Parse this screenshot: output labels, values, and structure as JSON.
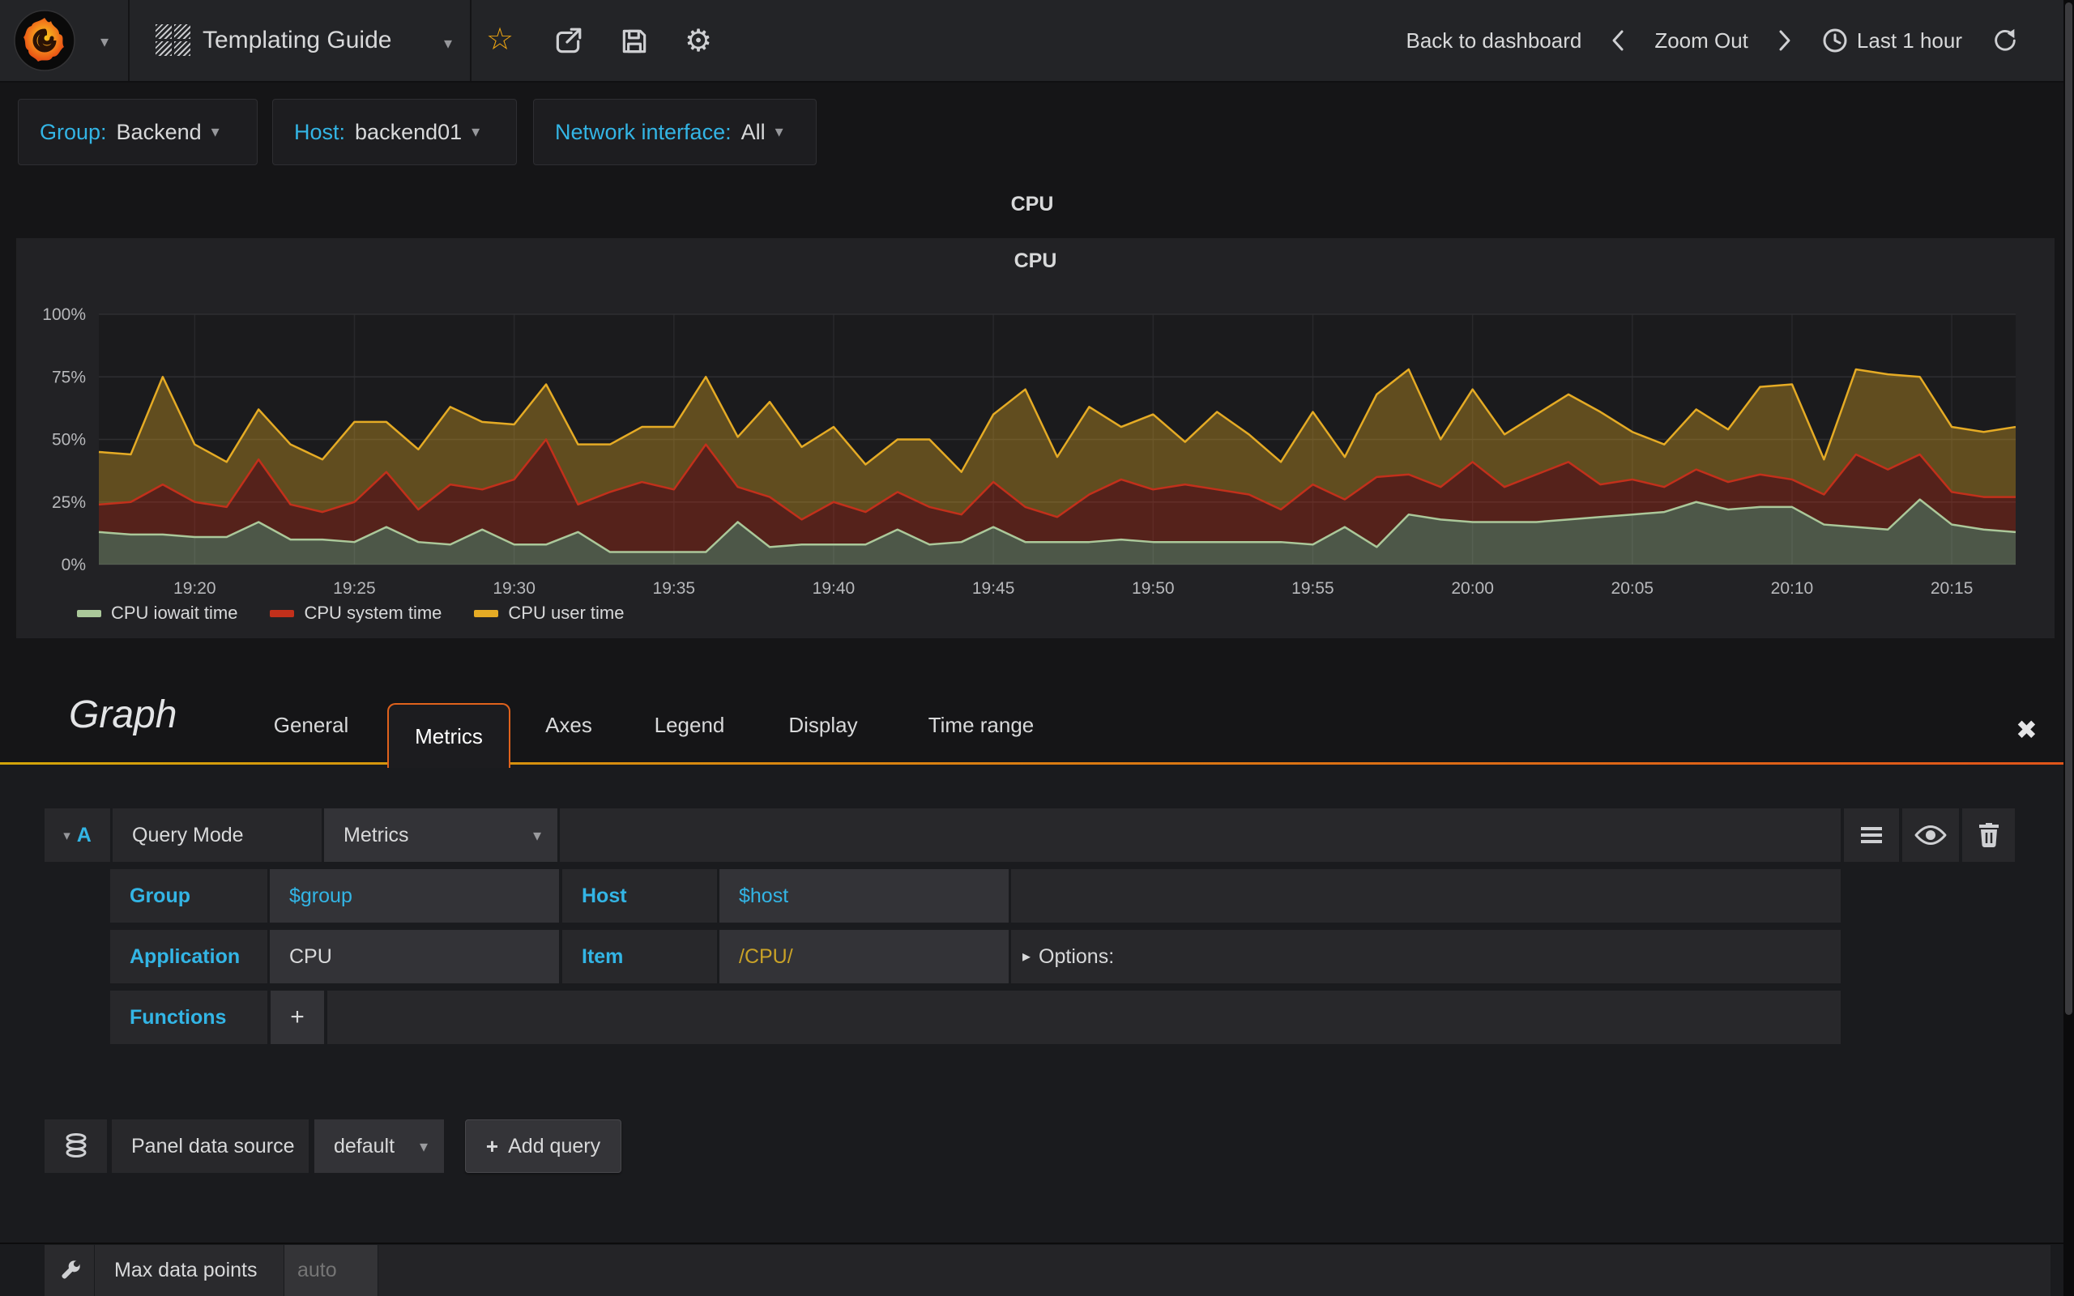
{
  "navbar": {
    "title": "Templating Guide",
    "back_to_dashboard": "Back to dashboard",
    "zoom_out": "Zoom Out",
    "time_range": "Last 1 hour"
  },
  "icons": {
    "star": "☆",
    "gear": "⚙",
    "close": "✖",
    "caret_down": "▾",
    "caret_right": "▸",
    "plus": "+"
  },
  "variables": [
    {
      "label": "Group:",
      "value": "Backend"
    },
    {
      "label": "Host:",
      "value": "backend01"
    },
    {
      "label": "Network interface:",
      "value": "All"
    }
  ],
  "row_title": "CPU",
  "panel": {
    "title": "CPU"
  },
  "chart_data": {
    "type": "area",
    "stacked": true,
    "title": "CPU",
    "xlabel": "",
    "ylabel": "",
    "ylim": [
      0,
      100
    ],
    "grid": true,
    "legend_position": "bottom",
    "x_start": "19:17",
    "x_end": "20:17",
    "x_ticks": [
      "19:20",
      "19:25",
      "19:30",
      "19:35",
      "19:40",
      "19:45",
      "19:50",
      "19:55",
      "20:00",
      "20:05",
      "20:10",
      "20:15"
    ],
    "y_ticks": [
      "0%",
      "25%",
      "50%",
      "75%",
      "100%"
    ],
    "series": [
      {
        "name": "CPU iowait time",
        "color": "#abc89a",
        "values": [
          13,
          12,
          12,
          11,
          11,
          17,
          10,
          10,
          9,
          15,
          9,
          8,
          14,
          8,
          8,
          13,
          5,
          5,
          5,
          5,
          17,
          7,
          8,
          8,
          8,
          14,
          8,
          9,
          15,
          9,
          9,
          9,
          10,
          9,
          9,
          9,
          9,
          9,
          8,
          15,
          7,
          20,
          18,
          17,
          17,
          17,
          18,
          19,
          20,
          21,
          25,
          22,
          23,
          23,
          16,
          15,
          14,
          26,
          16,
          14,
          13
        ]
      },
      {
        "name": "CPU system time",
        "color": "#c2301b",
        "values": [
          11,
          13,
          20,
          14,
          12,
          25,
          14,
          11,
          16,
          22,
          13,
          24,
          16,
          26,
          42,
          11,
          24,
          28,
          25,
          43,
          14,
          20,
          10,
          17,
          13,
          15,
          15,
          11,
          18,
          14,
          10,
          19,
          24,
          21,
          23,
          21,
          19,
          13,
          24,
          11,
          28,
          16,
          13,
          24,
          14,
          19,
          23,
          13,
          14,
          10,
          13,
          11,
          13,
          11,
          12,
          29,
          24,
          18,
          13,
          13,
          14
        ]
      },
      {
        "name": "CPU user time",
        "color": "#e5ab25",
        "values": [
          21,
          19,
          43,
          23,
          18,
          20,
          24,
          21,
          32,
          20,
          24,
          31,
          27,
          22,
          22,
          24,
          19,
          22,
          25,
          27,
          20,
          38,
          29,
          30,
          19,
          21,
          27,
          17,
          27,
          47,
          24,
          35,
          21,
          30,
          17,
          31,
          24,
          19,
          29,
          17,
          33,
          42,
          19,
          29,
          21,
          24,
          27,
          29,
          19,
          17,
          24,
          21,
          35,
          38,
          14,
          34,
          38,
          31,
          26,
          26,
          28
        ]
      }
    ]
  },
  "editor": {
    "panel_type": "Graph",
    "tabs": [
      "General",
      "Metrics",
      "Axes",
      "Legend",
      "Display",
      "Time range"
    ],
    "active_tab": "Metrics",
    "query": {
      "ref_id": "A",
      "query_mode_label": "Query Mode",
      "query_mode_value": "Metrics",
      "group_label": "Group",
      "group_value": "$group",
      "host_label": "Host",
      "host_value": "$host",
      "application_label": "Application",
      "application_value": "CPU",
      "item_label": "Item",
      "item_value": "/CPU/",
      "options_label": "Options:",
      "functions_label": "Functions"
    },
    "datasource": {
      "label": "Panel data source",
      "value": "default",
      "add_query_label": "Add query"
    },
    "max_data_points": {
      "label": "Max data points",
      "placeholder": "auto"
    }
  },
  "colors": {
    "accent_blue": "#33b5e5",
    "item_yellow": "#c9a227",
    "tab_gradient_left": "#d3a50a",
    "tab_gradient_right": "#e0551a"
  }
}
